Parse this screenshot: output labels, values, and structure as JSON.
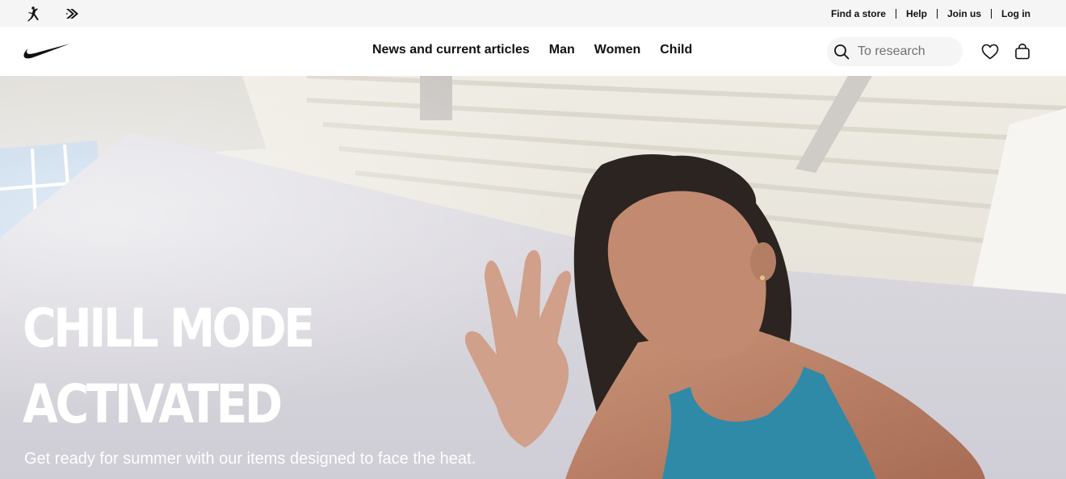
{
  "utility_bar": {
    "brand_icons": [
      "jordan-icon",
      "converse-icon"
    ],
    "links": [
      "Find a store",
      "Help",
      "Join us",
      "Log in"
    ]
  },
  "nav": {
    "logo": "nike-swoosh-icon",
    "items": [
      "News and current articles",
      "Man",
      "Women",
      "Child"
    ],
    "search_placeholder": "To research",
    "icons": [
      "search-icon",
      "heart-icon",
      "bag-icon"
    ]
  },
  "hero": {
    "headline_line1": "CHILL MODE",
    "headline_line2": "ACTIVATED",
    "subtitle": "Get ready for summer with our items designed to face the heat."
  },
  "colors": {
    "utility_bg": "#f5f5f5",
    "text": "#111111",
    "search_bg": "#f5f5f5",
    "tank_top": "#2f8aa8"
  }
}
